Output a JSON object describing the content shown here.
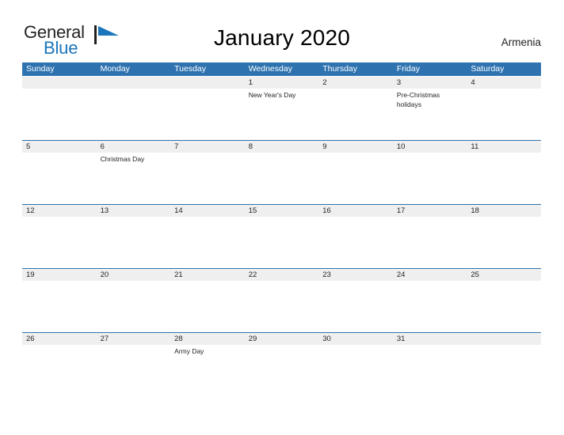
{
  "brand": {
    "name_part1": "General",
    "name_part2": "Blue",
    "mark_icon": "sailboat-sail-icon",
    "color_dark": "#231f20",
    "color_blue": "#1b75bb"
  },
  "header": {
    "title": "January 2020",
    "country": "Armenia",
    "accent_color": "#2e73b0"
  },
  "calendar": {
    "weekdays": [
      "Sunday",
      "Monday",
      "Tuesday",
      "Wednesday",
      "Thursday",
      "Friday",
      "Saturday"
    ],
    "weeks": [
      {
        "days": [
          {
            "number": "",
            "event": ""
          },
          {
            "number": "",
            "event": ""
          },
          {
            "number": "",
            "event": ""
          },
          {
            "number": "1",
            "event": "New Year's Day"
          },
          {
            "number": "2",
            "event": ""
          },
          {
            "number": "3",
            "event": "Pre-Christmas holidays"
          },
          {
            "number": "4",
            "event": ""
          }
        ]
      },
      {
        "days": [
          {
            "number": "5",
            "event": ""
          },
          {
            "number": "6",
            "event": "Christmas Day"
          },
          {
            "number": "7",
            "event": ""
          },
          {
            "number": "8",
            "event": ""
          },
          {
            "number": "9",
            "event": ""
          },
          {
            "number": "10",
            "event": ""
          },
          {
            "number": "11",
            "event": ""
          }
        ]
      },
      {
        "days": [
          {
            "number": "12",
            "event": ""
          },
          {
            "number": "13",
            "event": ""
          },
          {
            "number": "14",
            "event": ""
          },
          {
            "number": "15",
            "event": ""
          },
          {
            "number": "16",
            "event": ""
          },
          {
            "number": "17",
            "event": ""
          },
          {
            "number": "18",
            "event": ""
          }
        ]
      },
      {
        "days": [
          {
            "number": "19",
            "event": ""
          },
          {
            "number": "20",
            "event": ""
          },
          {
            "number": "21",
            "event": ""
          },
          {
            "number": "22",
            "event": ""
          },
          {
            "number": "23",
            "event": ""
          },
          {
            "number": "24",
            "event": ""
          },
          {
            "number": "25",
            "event": ""
          }
        ]
      },
      {
        "days": [
          {
            "number": "26",
            "event": ""
          },
          {
            "number": "27",
            "event": ""
          },
          {
            "number": "28",
            "event": "Army Day"
          },
          {
            "number": "29",
            "event": ""
          },
          {
            "number": "30",
            "event": ""
          },
          {
            "number": "31",
            "event": ""
          },
          {
            "number": "",
            "event": ""
          }
        ]
      }
    ]
  }
}
